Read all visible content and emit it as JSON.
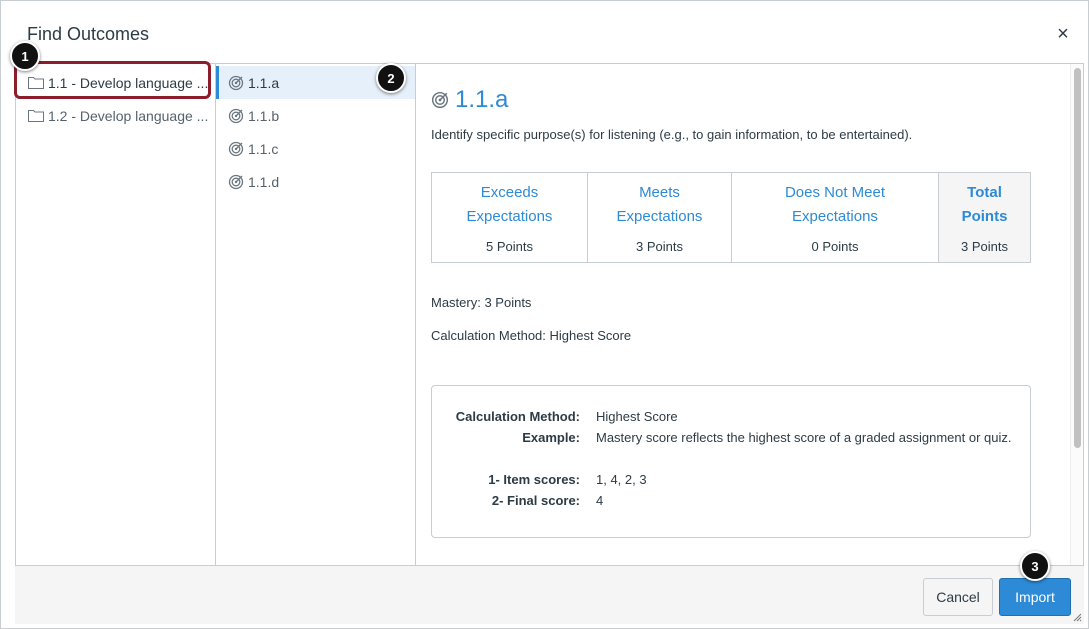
{
  "dialog": {
    "title": "Find Outcomes",
    "close_symbol": "×"
  },
  "groups": [
    {
      "label": "1.1 - Develop language ...",
      "icon": "folder-icon"
    },
    {
      "label": "1.2 - Develop language ...",
      "icon": "folder-icon"
    }
  ],
  "outcomes": [
    {
      "label": "1.1.a",
      "icon": "target-icon",
      "active": true
    },
    {
      "label": "1.1.b",
      "icon": "target-icon"
    },
    {
      "label": "1.1.c",
      "icon": "target-icon"
    },
    {
      "label": "1.1.d",
      "icon": "target-icon"
    }
  ],
  "detail": {
    "title": "1.1.a",
    "description": "Identify specific purpose(s) for listening (e.g., to gain information, to be entertained).",
    "ratings": [
      {
        "desc_line1": "Exceeds",
        "desc_line2": "Expectations",
        "points": "5 Points"
      },
      {
        "desc_line1": "Meets",
        "desc_line2": "Expectations",
        "points": "3 Points"
      },
      {
        "desc_line1": "Does Not Meet",
        "desc_line2": "Expectations",
        "points": "0 Points"
      },
      {
        "desc_line1": "Total",
        "desc_line2": "Points",
        "points": "3 Points"
      }
    ],
    "mastery": "Mastery: 3 Points",
    "calculation_method": "Calculation Method: Highest Score",
    "calc_box": {
      "method_label": "Calculation Method:",
      "method_value": "Highest Score",
      "example_label": "Example:",
      "example_value": "Mastery score reflects the highest score of a graded assignment or quiz.",
      "item_scores_label": "1- Item scores:",
      "item_scores_value": "1, 4, 2, 3",
      "final_score_label": "2- Final score:",
      "final_score_value": "4"
    }
  },
  "footer": {
    "cancel_label": "Cancel",
    "import_label": "Import"
  },
  "callouts": [
    "1",
    "2",
    "3"
  ],
  "colors": {
    "accent": "#2d8ad6",
    "highlight_border": "#8b1e2a",
    "active_row_bg": "#e6f0fa",
    "footer_bg": "#f5f5f5"
  }
}
